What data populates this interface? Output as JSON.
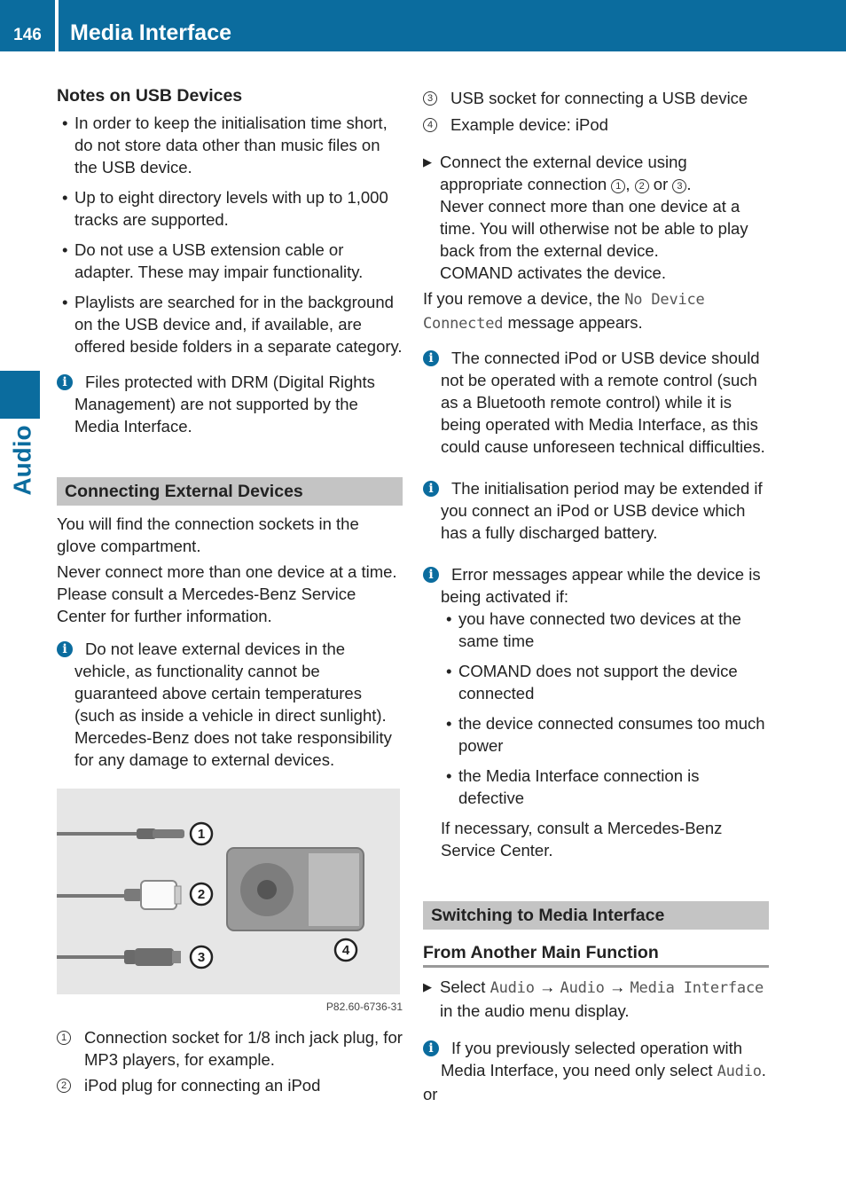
{
  "header": {
    "page_number": "146",
    "title": "Media Interface",
    "color": "#0b6c9e"
  },
  "side_tab": {
    "label": "Audio"
  },
  "left": {
    "notes_heading": "Notes on USB Devices",
    "notes_bullets": [
      "In order to keep the initialisation time short, do not store data other than music files on the USB device.",
      "Up to eight directory levels with up to 1,000 tracks are supported.",
      "Do not use a USB extension cable or adapter. These may impair functionality.",
      "Playlists are searched for in the background on the USB device and, if available, are offered beside folders in a separate category."
    ],
    "drm_info": "Files protected with DRM (Digital Rights Management) are not supported by the Media Interface.",
    "section_connecting": "Connecting External Devices",
    "para1": "You will find the connection sockets in the glove compartment.",
    "para2": "Never connect more than one device at a time. Please consult a Mercedes-Benz Service Center for further information.",
    "temp_info": "Do not leave external devices in the vehicle, as functionality cannot be guaranteed above certain temperatures (such as inside a vehicle in direct sunlight). Mercedes-Benz does not take responsibility for any damage to external devices.",
    "figure": {
      "callouts": [
        "1",
        "2",
        "3",
        "4"
      ],
      "caption": "P82.60-6736-31"
    },
    "legend": [
      {
        "num": "1",
        "text": "Connection socket for 1/8 inch jack plug, for MP3 players, for example."
      },
      {
        "num": "2",
        "text": "iPod plug for connecting an iPod"
      }
    ]
  },
  "right": {
    "legend": [
      {
        "num": "3",
        "text": "USB socket for connecting a USB device"
      },
      {
        "num": "4",
        "text": "Example device: iPod"
      }
    ],
    "step1": {
      "line1": "Connect the external device using appropriate connection",
      "refs": [
        "1",
        "2",
        "3"
      ],
      "sep_comma": ",",
      "sep_or": "or",
      "rest": "Never connect more than one device at a time. You will otherwise not be able to play back from the external device.",
      "rest2": "COMAND activates the device."
    },
    "remove_text_before": "If you remove a device, the",
    "remove_display": "No Device Connected",
    "remove_text_after": "message appears.",
    "info_remote": "The connected iPod or USB device should not be operated with a remote control (such as a Bluetooth remote control) while it is being operated with Media Interface, as this could cause unforeseen technical difficulties.",
    "info_init": "The initialisation period may be extended if you connect an iPod or USB device which has a fully discharged battery.",
    "info_errors": "Error messages appear while the device is being activated if:",
    "error_bullets": [
      "you have connected two devices at the same time",
      "COMAND does not support the device connected",
      "the device connected consumes too much power",
      "the Media Interface connection is defective"
    ],
    "consult": "If necessary, consult a Mercedes-Benz Service Center.",
    "section_switching": "Switching to Media Interface",
    "sub_heading": "From Another Main Function",
    "select_step": {
      "prefix": "Select",
      "path": [
        "Audio",
        "Audio",
        "Media Interface"
      ],
      "arrow": "→",
      "suffix": "in the audio menu display."
    },
    "info_prev_before": "If you previously selected operation with Media Interface, you need only select",
    "info_prev_display": "Audio",
    "or_text": "or"
  }
}
